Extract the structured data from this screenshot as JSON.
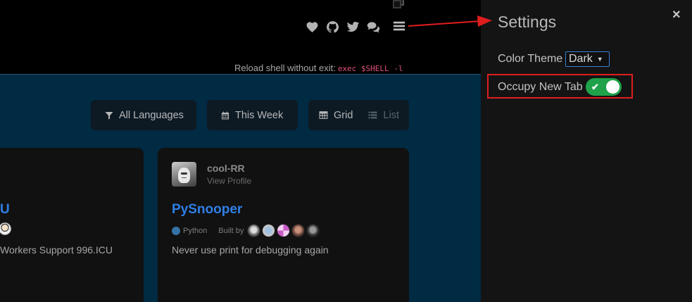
{
  "header": {
    "icons": [
      "heart-icon",
      "github-icon",
      "twitter-icon",
      "comments-icon"
    ],
    "reload_text": "Reload shell without exit:",
    "reload_command": "exec $SHELL -l"
  },
  "filters": {
    "language_label": "All Languages",
    "period_label": "This Week",
    "view_grid_label": "Grid",
    "view_list_label": "List"
  },
  "cards": {
    "left": {
      "title": "U",
      "description": "Workers Support 996.ICU"
    },
    "right": {
      "author": "cool-RR",
      "view_profile": "View Profile",
      "title": "PySnooper",
      "language": "Python",
      "language_color": "#3572a5",
      "built_by": "Built by",
      "description": "Never use print for debugging again"
    }
  },
  "settings": {
    "title": "Settings",
    "close_label": "×",
    "color_theme_label": "Color Theme",
    "color_theme_value": "Dark",
    "occupy_tab_label": "Occupy New Tab",
    "occupy_tab_enabled": true
  },
  "colors": {
    "accent": "#2f7fe6",
    "toggle_on": "#1fa24a",
    "highlight_border": "#e01d1d",
    "annotation_arrow": "#e01d1d"
  }
}
